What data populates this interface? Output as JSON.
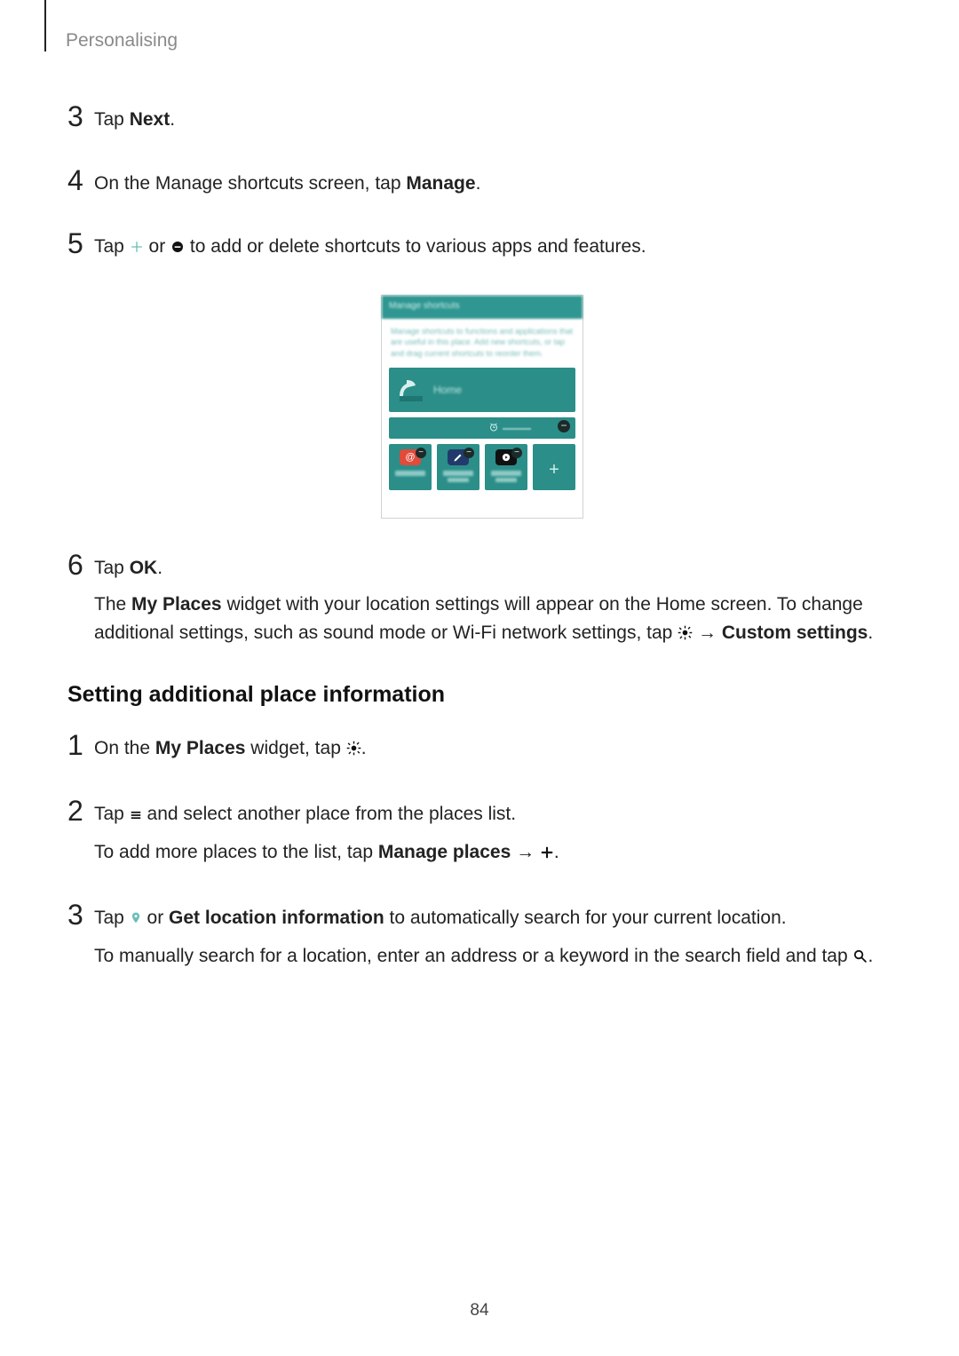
{
  "header": {
    "section": "Personalising"
  },
  "stepsA": [
    {
      "num": "3",
      "lines": [
        {
          "parts": [
            {
              "t": "Tap "
            },
            {
              "t": "Next",
              "b": true
            },
            {
              "t": "."
            }
          ]
        }
      ]
    },
    {
      "num": "4",
      "lines": [
        {
          "parts": [
            {
              "t": "On the Manage shortcuts screen, tap "
            },
            {
              "t": "Manage",
              "b": true
            },
            {
              "t": "."
            }
          ]
        }
      ]
    },
    {
      "num": "5",
      "lines": [
        {
          "parts": [
            {
              "t": "Tap "
            },
            {
              "icon": "plus-thin"
            },
            {
              "t": " or "
            },
            {
              "icon": "minus-circle"
            },
            {
              "t": " to add or delete shortcuts to various apps and features."
            }
          ]
        }
      ]
    }
  ],
  "screenshot": {
    "title": "Manage shortcuts",
    "desc": "Manage shortcuts to functions and applications that are useful in this place. Add new shortcuts, or tap and drag current shortcuts to reorder them.",
    "home_label": "Home"
  },
  "stepsB": [
    {
      "num": "6",
      "lines": [
        {
          "parts": [
            {
              "t": "Tap "
            },
            {
              "t": "OK",
              "b": true
            },
            {
              "t": "."
            }
          ]
        },
        {
          "parts": [
            {
              "t": "The "
            },
            {
              "t": "My Places",
              "b": true
            },
            {
              "t": " widget with your location settings will appear on the Home screen. To change additional settings, such as sound mode or Wi-Fi network settings, tap "
            },
            {
              "icon": "gear"
            },
            {
              "t": " → "
            },
            {
              "t": "Custom settings",
              "b": true
            },
            {
              "t": "."
            }
          ]
        }
      ]
    }
  ],
  "subhead": "Setting additional place information",
  "stepsC": [
    {
      "num": "1",
      "lines": [
        {
          "parts": [
            {
              "t": "On the "
            },
            {
              "t": "My Places",
              "b": true
            },
            {
              "t": " widget, tap "
            },
            {
              "icon": "gear"
            },
            {
              "t": "."
            }
          ]
        }
      ]
    },
    {
      "num": "2",
      "lines": [
        {
          "parts": [
            {
              "t": "Tap "
            },
            {
              "icon": "menu"
            },
            {
              "t": " and select another place from the places list."
            }
          ]
        },
        {
          "parts": [
            {
              "t": "To add more places to the list, tap "
            },
            {
              "t": "Manage places",
              "b": true
            },
            {
              "t": " → "
            },
            {
              "icon": "plus-bold"
            },
            {
              "t": "."
            }
          ]
        }
      ]
    },
    {
      "num": "3",
      "lines": [
        {
          "parts": [
            {
              "t": "Tap "
            },
            {
              "icon": "pin"
            },
            {
              "t": " or "
            },
            {
              "t": "Get location information",
              "b": true
            },
            {
              "t": " to automatically search for your current location."
            }
          ]
        },
        {
          "parts": [
            {
              "t": "To manually search for a location, enter an address or a keyword in the search field and tap "
            },
            {
              "icon": "search"
            },
            {
              "t": "."
            }
          ]
        }
      ]
    }
  ],
  "page_number": "84"
}
